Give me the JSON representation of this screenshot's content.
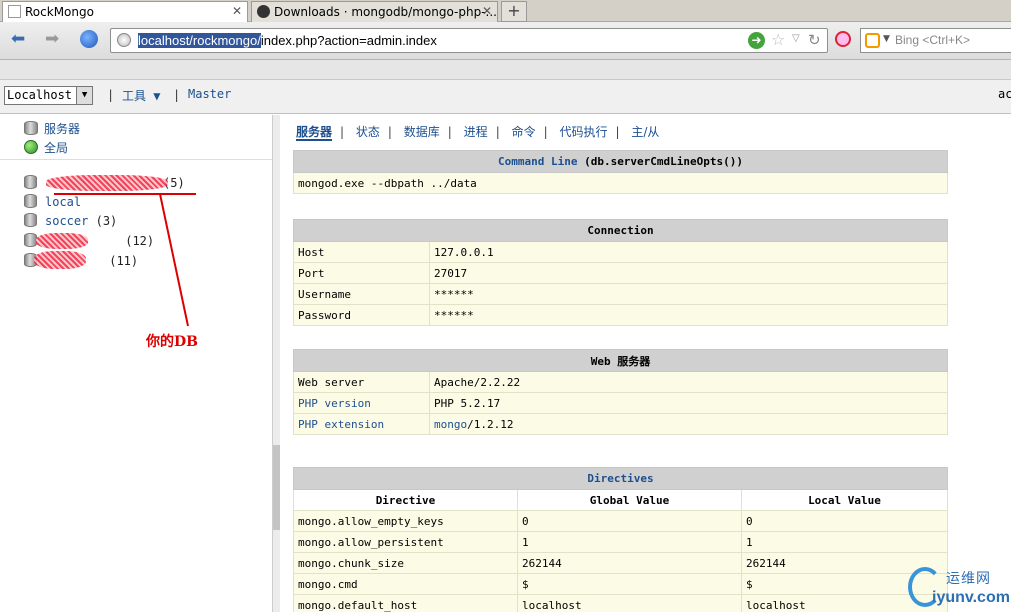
{
  "browser": {
    "tabs": [
      {
        "title": "RockMongo",
        "active": true
      },
      {
        "title": "Downloads · mongodb/mongo-php-...",
        "active": false
      }
    ],
    "url_selected": "localhost/rockmongo/",
    "url_rest": "index.php?action=admin.index",
    "search_placeholder": "Bing <Ctrl+K>"
  },
  "appbar": {
    "host": "Localhost",
    "tools_label": "工具 ▼",
    "master_label": "Master",
    "user_fragment": "ac"
  },
  "sidebar": {
    "links": [
      {
        "label": "服务器",
        "icon": "database-icon"
      },
      {
        "label": "全局",
        "icon": "globe-icon"
      }
    ],
    "databases": [
      {
        "name": "",
        "count": "(5)"
      },
      {
        "name": "local",
        "count": ""
      },
      {
        "name": "soccer",
        "count": "(3)"
      },
      {
        "name": "",
        "count": "(12)"
      },
      {
        "name": "",
        "count": "(11)"
      }
    ],
    "annotation": "你的DB"
  },
  "main": {
    "tabs": [
      "服务器",
      "状态",
      "数据库",
      "进程",
      "命令",
      "代码执行",
      "主/从"
    ],
    "command_line": {
      "title_link": "Command Line",
      "title_rest": " (db.serverCmdLineOpts())",
      "value": "mongod.exe --dbpath ../data"
    },
    "connection": {
      "title": "Connection",
      "rows": [
        {
          "label": "Host",
          "value": "127.0.0.1"
        },
        {
          "label": "Port",
          "value": "27017"
        },
        {
          "label": "Username",
          "value": "******"
        },
        {
          "label": "Password",
          "value": "******"
        }
      ]
    },
    "web_server": {
      "title": "Web 服务器",
      "rows": [
        {
          "label": "Web server",
          "value": "Apache/2.2.22",
          "label_link": false
        },
        {
          "label": "PHP version",
          "value": "PHP 5.2.17",
          "label_link": true
        },
        {
          "label": "PHP extension",
          "value_link": "mongo",
          "value": "/1.2.12",
          "label_link": true
        }
      ]
    },
    "directives": {
      "title": "Directives",
      "headers": [
        "Directive",
        "Global Value",
        "Local Value"
      ],
      "rows": [
        [
          "mongo.allow_empty_keys",
          "0",
          "0"
        ],
        [
          "mongo.allow_persistent",
          "1",
          "1"
        ],
        [
          "mongo.chunk_size",
          "262144",
          "262144"
        ],
        [
          "mongo.cmd",
          "$",
          "$"
        ],
        [
          "mongo.default_host",
          "localhost",
          "localhost"
        ]
      ]
    }
  },
  "watermark": {
    "cn": "运维网",
    "en": "iyunv.com"
  },
  "colors": {
    "link": "#1d4f8f",
    "header_bg": "#d0d0d0",
    "cell_bg": "#fcfbe6",
    "annotation": "#dd0000"
  }
}
